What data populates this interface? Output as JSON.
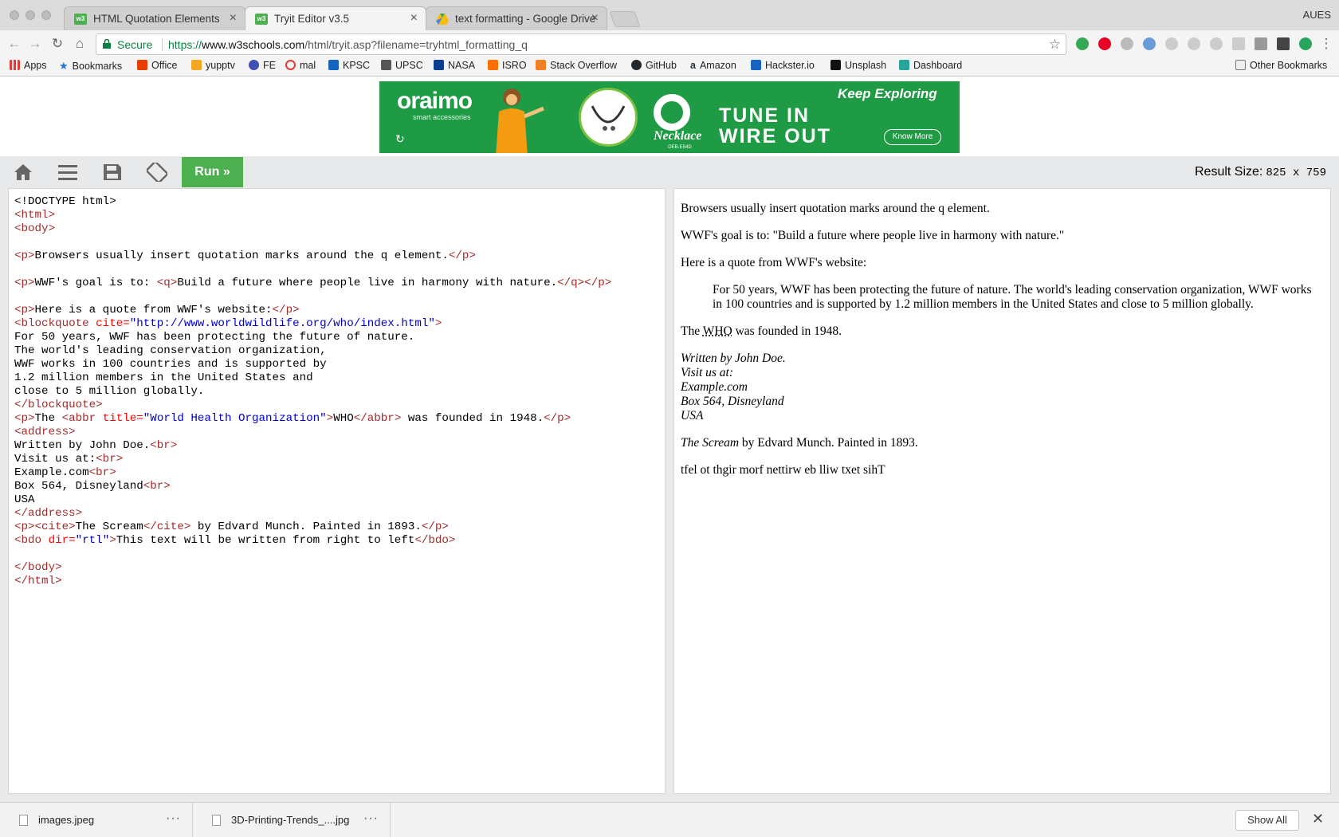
{
  "browser": {
    "tabs": [
      {
        "title": "HTML Quotation Elements",
        "favicon": "w3-icon",
        "active": false
      },
      {
        "title": "Tryit Editor v3.5",
        "favicon": "w3-icon",
        "active": true
      },
      {
        "title": "text formatting - Google Drive",
        "favicon": "drive-icon",
        "active": false
      }
    ],
    "profile_name": "AUES",
    "secure_label": "Secure",
    "url_scheme": "https://",
    "url_host": "www.w3schools.com",
    "url_path": "/html/tryit.asp?filename=tryhtml_formatting_q"
  },
  "bookmarks": [
    {
      "label": "Apps",
      "icon": "apps-grid-icon",
      "color": "#e53935"
    },
    {
      "label": "Bookmarks",
      "icon": "star-icon",
      "color": "#1a73e8"
    },
    {
      "label": "Office",
      "icon": "office-icon",
      "color": "#eb3c00"
    },
    {
      "label": "yupptv",
      "icon": "yupptv-icon",
      "color": "#f5a623"
    },
    {
      "label": "FE",
      "icon": "fe-icon",
      "color": "#3f51b5"
    },
    {
      "label": "mal",
      "icon": "mal-icon",
      "color": "#e53935"
    },
    {
      "label": "KPSC",
      "icon": "kpsc-icon",
      "color": "#1565c0"
    },
    {
      "label": "UPSC",
      "icon": "upsc-icon",
      "color": "#555555"
    },
    {
      "label": "NASA",
      "icon": "nasa-icon",
      "color": "#0b3d91"
    },
    {
      "label": "ISRO",
      "icon": "isro-icon",
      "color": "#ff6f00"
    },
    {
      "label": "Stack Overflow",
      "icon": "stackoverflow-icon",
      "color": "#f48024"
    },
    {
      "label": "GitHub",
      "icon": "github-icon",
      "color": "#24292e"
    },
    {
      "label": "Amazon",
      "icon": "amazon-icon",
      "color": "#232f3e"
    },
    {
      "label": "Hackster.io",
      "icon": "hackster-icon",
      "color": "#1565c0"
    },
    {
      "label": "Unsplash",
      "icon": "camera-icon",
      "color": "#111111"
    },
    {
      "label": "Dashboard",
      "icon": "dashboard-icon",
      "color": "#26a69a"
    }
  ],
  "other_bookmarks": "Other Bookmarks",
  "ad": {
    "brand": "oraimo",
    "brand_sub": "smart accessories",
    "product": "Necklace",
    "model": "OEB-E54D",
    "headline_1": "TUNE IN",
    "headline_2": "WIRE OUT",
    "tagline": "Keep Exploring",
    "cta": "Know More",
    "bg_color": "#1f9a45"
  },
  "tryit": {
    "run_label": "Run »",
    "result_size_label": "Result Size:",
    "result_size_value": "825 x 759",
    "run_color": "#4caf50"
  },
  "code": {
    "l01": "<!DOCTYPE html>",
    "l04_text": "Browsers usually insert quotation marks around the q element.",
    "l06_pre": "WWF's goal is to: ",
    "l06_q": "Build a future where people live in harmony with nature.",
    "l08_text": "Here is a quote from WWF's website:",
    "l09_cite": "\"http://www.worldwildlife.org/who/index.html\"",
    "bq_lines": [
      "For 50 years, WWF has been protecting the future of nature.",
      "The world's leading conservation organization,",
      "WWF works in 100 countries and is supported by",
      "1.2 million members in the United States and",
      "close to 5 million globally."
    ],
    "abbr_pre": "The ",
    "abbr_title": "\"World Health Organization\"",
    "abbr_text": "WHO",
    "abbr_post": " was founded in 1948.",
    "addr_lines": [
      "Written by John Doe.",
      "Visit us at:",
      "Example.com",
      "Box 564, Disneyland",
      "USA"
    ],
    "cite_text": "The Scream",
    "cite_post": " by Edvard Munch. Painted in 1893.",
    "bdo_dir": "\"rtl\"",
    "bdo_text": "This text will be written from right to left"
  },
  "result": {
    "p1": "Browsers usually insert quotation marks around the q element.",
    "p2": "WWF's goal is to: \"Build a future where people live in harmony with nature.\"",
    "p3": "Here is a quote from WWF's website:",
    "blockquote": "For 50 years, WWF has been protecting the future of nature. The world's leading conservation organization, WWF works in 100 countries and is supported by 1.2 million members in the United States and close to 5 million globally.",
    "abbr_pre": "The ",
    "abbr": "WHO",
    "abbr_post": " was founded in 1948.",
    "address_lines": [
      "Written by John Doe.",
      "Visit us at:",
      "Example.com",
      "Box 564, Disneyland",
      "USA"
    ],
    "cite": "The Scream",
    "cite_post": " by Edvard Munch. Painted in 1893.",
    "bdo": "tfel ot thgir morf nettirw eb lliw txet sihT"
  },
  "downloads": [
    {
      "name": "images.jpeg"
    },
    {
      "name": "3D-Printing-Trends_....jpg"
    }
  ],
  "show_all": "Show All"
}
